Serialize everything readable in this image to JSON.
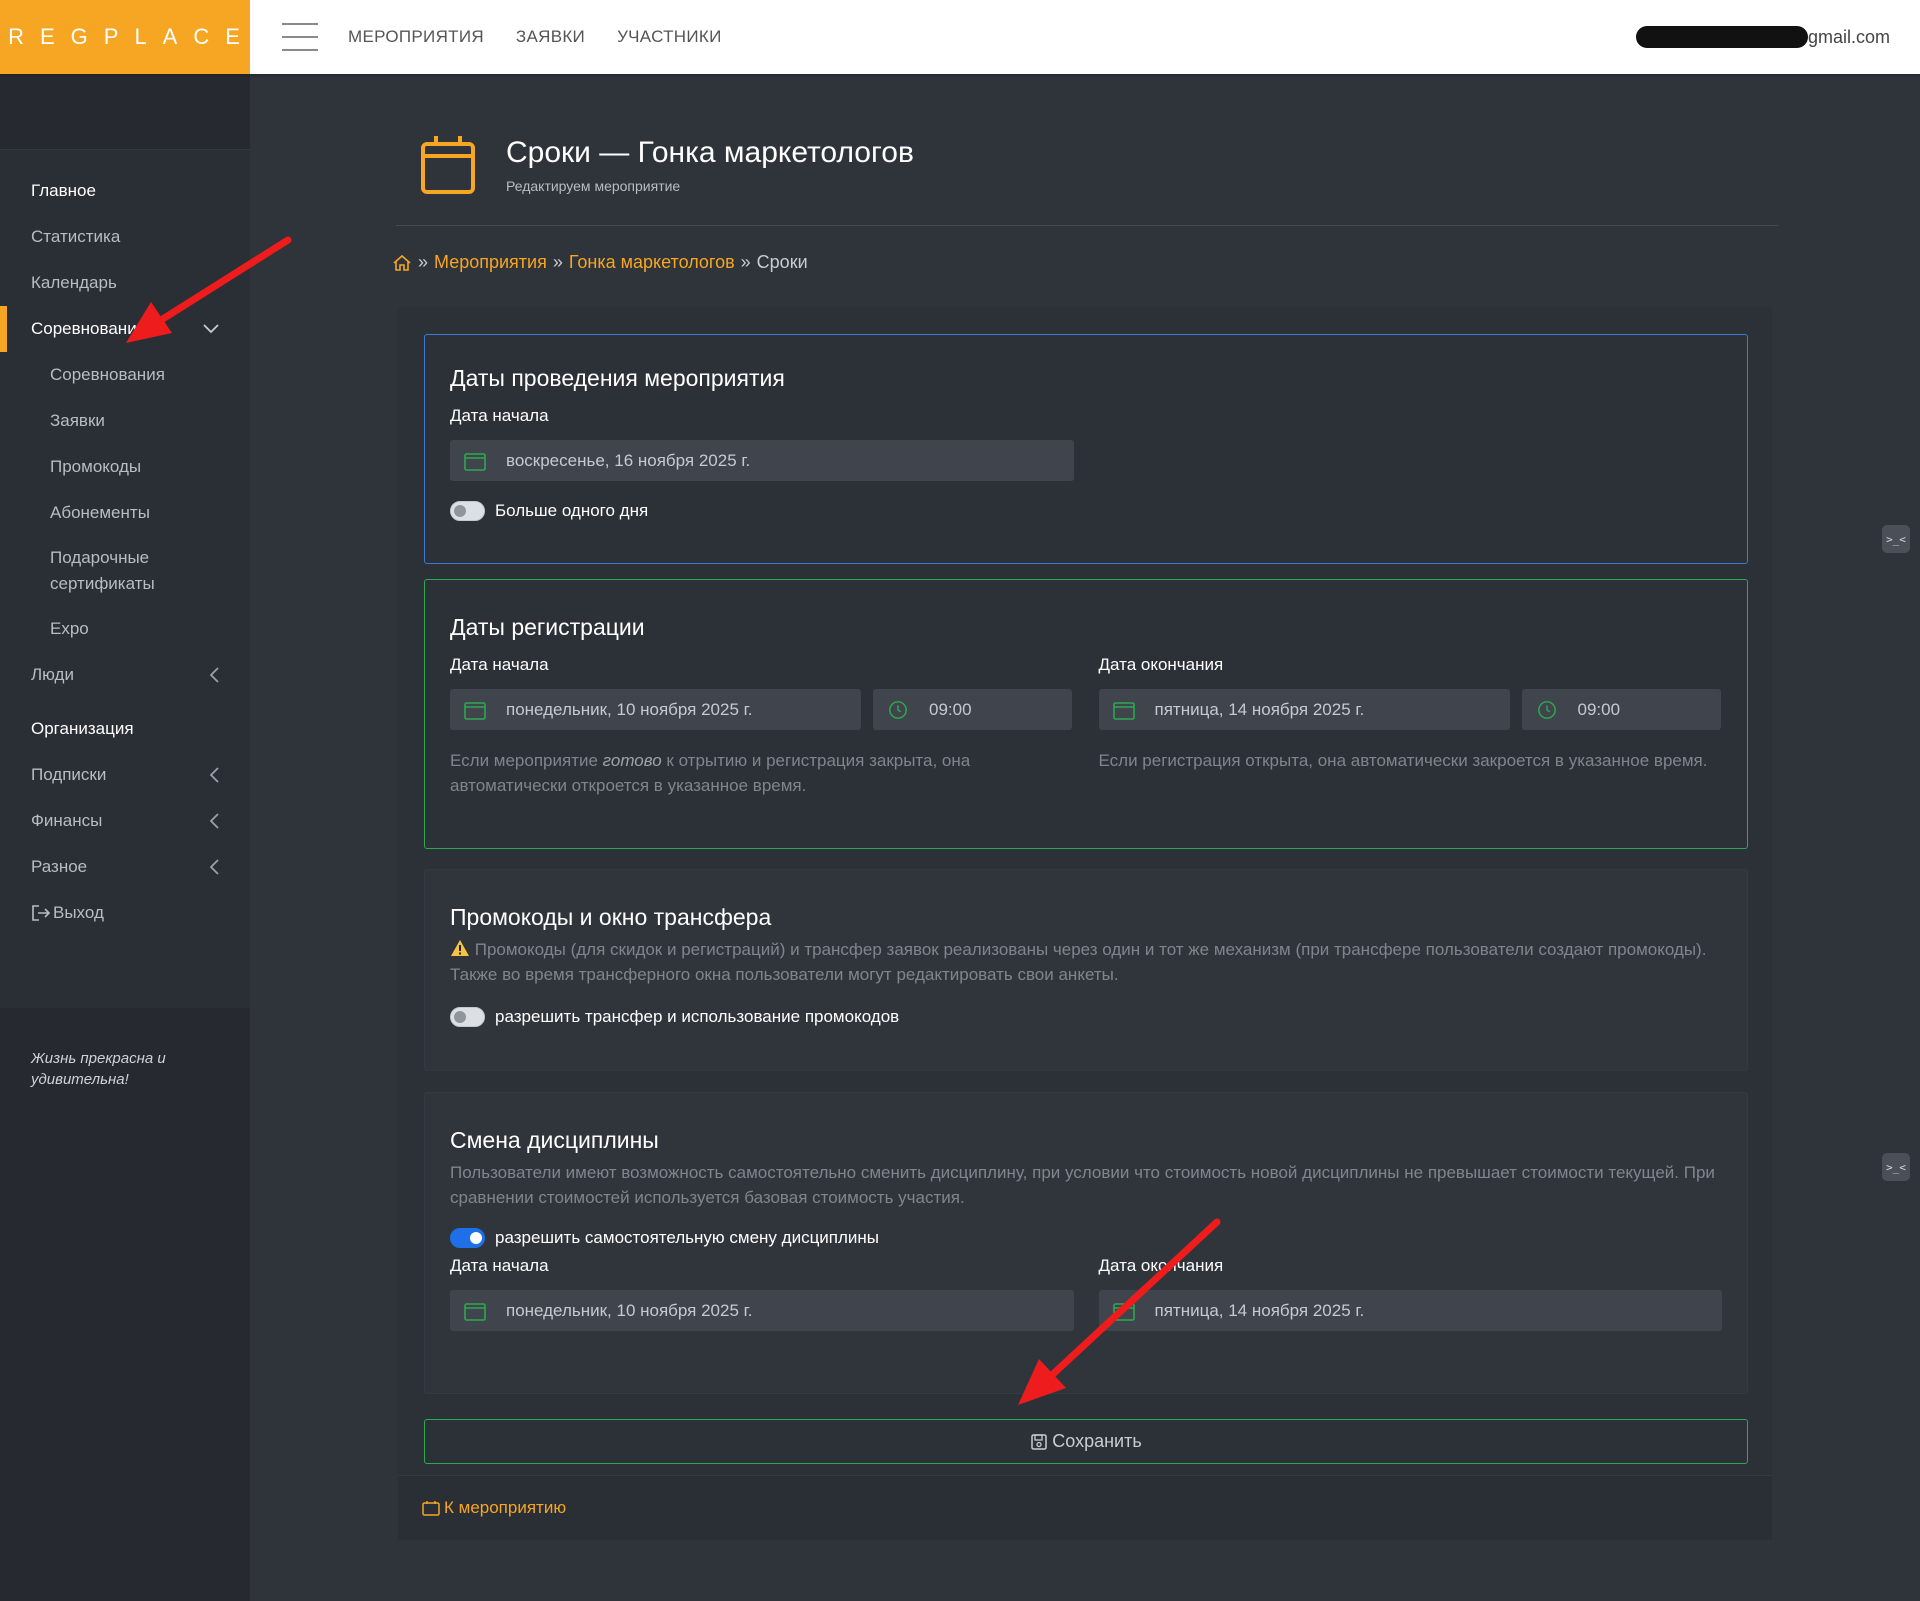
{
  "brand": "REGPLACE",
  "topnav": {
    "events": "МЕРОПРИЯТИЯ",
    "applications": "ЗАЯВКИ",
    "participants": "УЧАСТНИКИ"
  },
  "user": {
    "email_suffix": "gmail.com"
  },
  "sidebar": {
    "section_main": "Главное",
    "statistics": "Статистика",
    "calendar": "Календарь",
    "competitions": "Соревнования",
    "sub": {
      "competitions": "Соревнования",
      "applications": "Заявки",
      "promocodes": "Промокоды",
      "subscriptions": "Абонементы",
      "gift_cert_1": "Подарочные",
      "gift_cert_2": "сертификаты",
      "expo": "Expo"
    },
    "people": "Люди",
    "section_org": "Организация",
    "subscriptions": "Подписки",
    "finance": "Финансы",
    "misc": "Разное",
    "logout": "Выход",
    "footer_1": "Жизнь прекрасна и",
    "footer_2": "удивительна!"
  },
  "header": {
    "title": "Сроки — Гонка маркетологов",
    "subtitle": "Редактируем мероприятие"
  },
  "breadcrumb": {
    "sep": "»",
    "events": "Мероприятия",
    "event": "Гонка маркетологов",
    "current": "Сроки"
  },
  "event_dates": {
    "title": "Даты проведения мероприятия",
    "start_label": "Дата начала",
    "start_value": "воскресенье, 16 ноября 2025 г.",
    "multi_day_label": "Больше одного дня",
    "multi_day_on": false
  },
  "registration": {
    "title": "Даты регистрации",
    "start_label": "Дата начала",
    "start_date": "понедельник, 10 ноября 2025 г.",
    "start_time": "09:00",
    "end_label": "Дата окончания",
    "end_date": "пятница, 14 ноября 2025 г.",
    "end_time": "09:00",
    "hint_start_1": "Если мероприятие ",
    "hint_start_em": "готово",
    "hint_start_2": " к отрытию и регистрация закрыта, она автоматически откроется в указанное время.",
    "hint_end": "Если регистрация открыта, она автоматически закроется в указанное время."
  },
  "promo": {
    "title": "Промокоды и окно трансфера",
    "warning": "Промокоды (для скидок и регистраций) и трансфер заявок реализованы через один и тот же механизм (при трансфере пользователи создают промокоды). Также во время трансферного окна пользователи могут редактировать свои анкеты.",
    "toggle_label": "разрешить трансфер и использование промокодов",
    "toggle_on": false
  },
  "discipline": {
    "title": "Смена дисциплины",
    "description": "Пользователи имеют возможность самостоятельно сменить дисциплину, при условии что стоимость новой дисциплины не превышает стоимости текущей. При сравнении стоимостей используется базовая стоимость участия.",
    "toggle_label": "разрешить самостоятельную смену дисциплины",
    "toggle_on": true,
    "start_label": "Дата начала",
    "start_date": "понедельник, 10 ноября 2025 г.",
    "end_label": "Дата окончания",
    "end_date": "пятница, 14 ноября 2025 г."
  },
  "actions": {
    "save": "Сохранить",
    "back": "К мероприятию"
  },
  "colors": {
    "accent": "#f6a623",
    "blue_border": "#3a7bd5",
    "green_border": "#2ea84f",
    "toggle_on": "#1e6fe8",
    "annotation_arrow": "#ee1c1c"
  }
}
